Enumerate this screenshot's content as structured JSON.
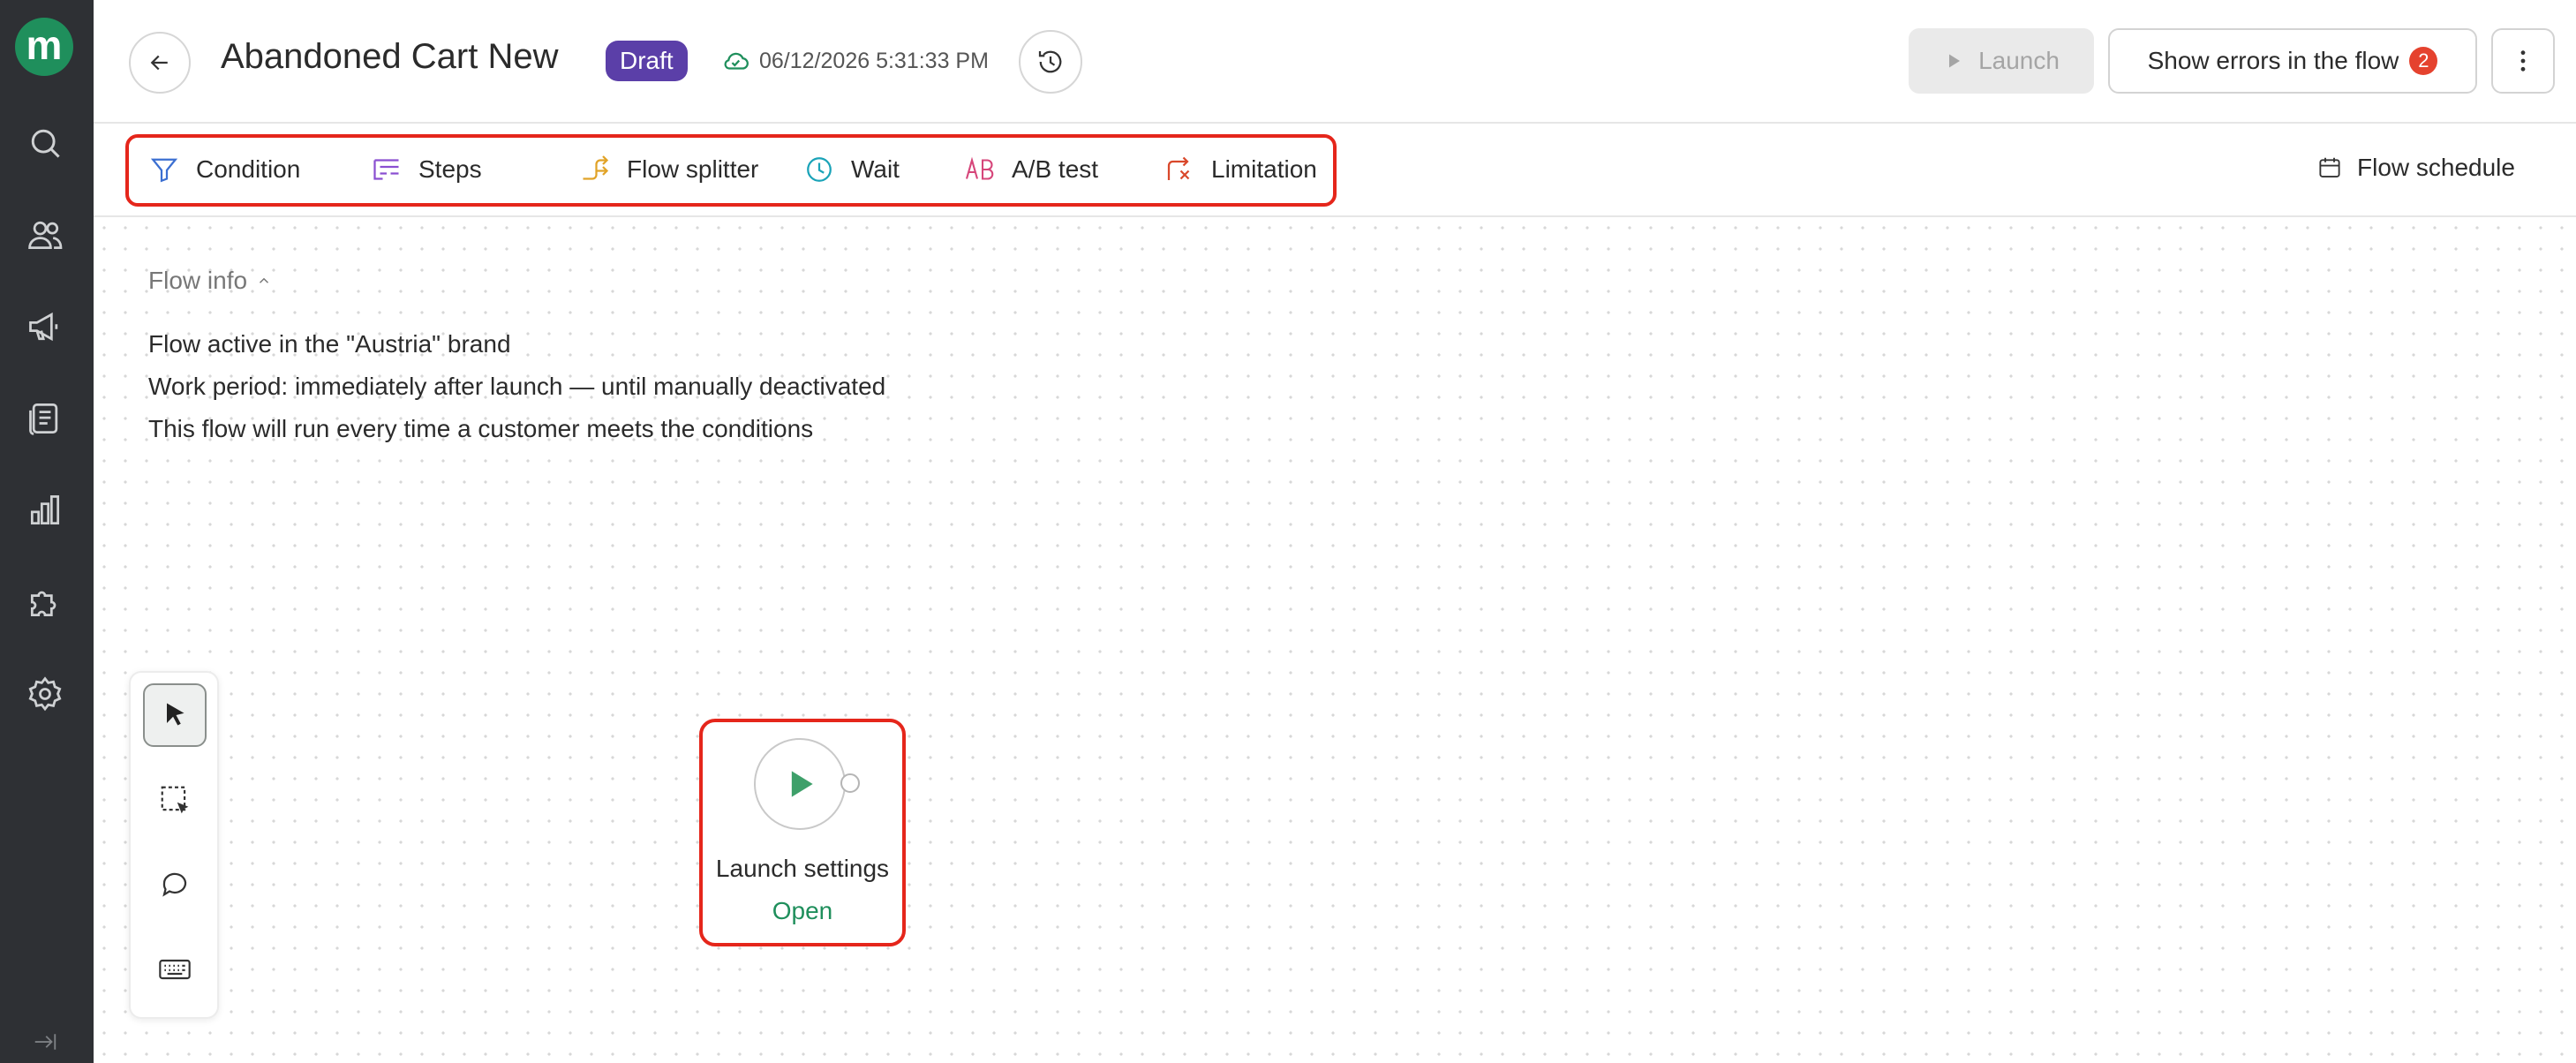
{
  "colors": {
    "brand": "#1f8f5c",
    "draft_badge": "#5b3fa8",
    "error": "#e5422e",
    "highlight": "#e5261b",
    "sidebar_bg": "#2e3034"
  },
  "sidebar": {
    "logo": "m",
    "items": [
      {
        "icon": "search-icon"
      },
      {
        "icon": "users-icon"
      },
      {
        "icon": "megaphone-icon"
      },
      {
        "icon": "document-icon"
      },
      {
        "icon": "bar-chart-icon"
      },
      {
        "icon": "puzzle-icon"
      },
      {
        "icon": "gear-icon"
      }
    ],
    "collapse_icon": "collapse-arrow-icon"
  },
  "header": {
    "title": "Abandoned Cart New",
    "status_badge": "Draft",
    "saved_timestamp": "06/12/2026 5:31:33 PM",
    "launch_label": "Launch",
    "errors_label": "Show errors in the flow",
    "errors_count": "2"
  },
  "toolbar": {
    "tools": [
      {
        "label": "Condition",
        "icon": "filter-icon"
      },
      {
        "label": "Steps",
        "icon": "steps-icon"
      },
      {
        "label": "Flow splitter",
        "icon": "splitter-icon"
      },
      {
        "label": "Wait",
        "icon": "clock-icon"
      },
      {
        "label": "A/B test",
        "icon": "ab-icon"
      },
      {
        "label": "Limitation",
        "icon": "limitation-icon"
      }
    ],
    "schedule_label": "Flow schedule"
  },
  "flow_info": {
    "heading": "Flow info",
    "lines": [
      "Flow active in the \"Austria\" brand",
      "Work period: immediately after launch — until manually deactivated",
      "This flow will run every time a customer meets the conditions"
    ]
  },
  "canvas_tools": [
    {
      "icon": "pointer-icon",
      "active": true
    },
    {
      "icon": "select-area-icon",
      "active": false
    },
    {
      "icon": "comment-icon",
      "active": false
    },
    {
      "icon": "keyboard-icon",
      "active": false
    }
  ],
  "node": {
    "label": "Launch settings",
    "action": "Open"
  }
}
